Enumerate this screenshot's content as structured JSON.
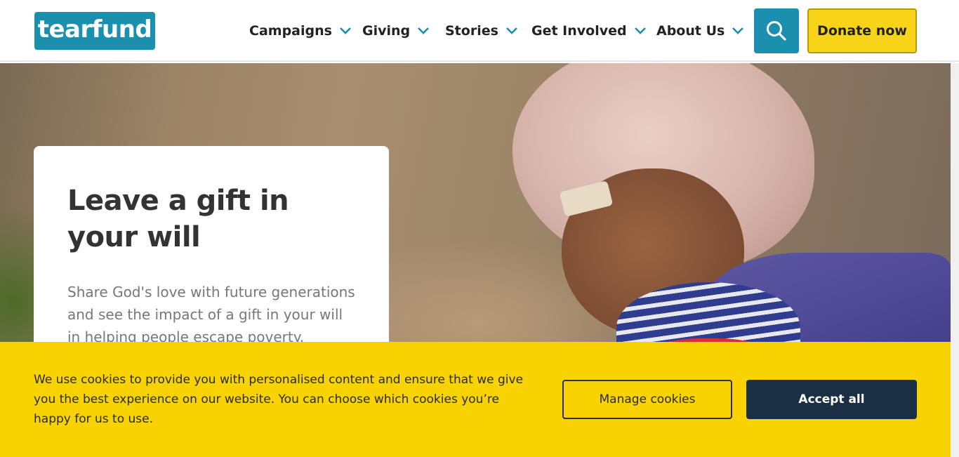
{
  "header": {
    "logo_text": "tearfund",
    "nav": [
      {
        "label": "Campaigns"
      },
      {
        "label": "Giving"
      },
      {
        "label": "Stories"
      },
      {
        "label": "Get Involved"
      },
      {
        "label": "About Us"
      }
    ],
    "search_icon": "search-icon",
    "donate_label": "Donate now"
  },
  "hero": {
    "title": "Leave a gift in your will",
    "description": "Share God's love with future generations and see the impact of a gift in your will in helping people escape poverty."
  },
  "cookie_banner": {
    "message": "We use cookies to provide you with personalised content and ensure that we give you the best experience on our website. You can choose which cookies you’re happy for us to use.",
    "manage_label": "Manage cookies",
    "accept_label": "Accept all"
  },
  "colors": {
    "brand_teal": "#1a8fae",
    "donate_yellow": "#f7d417",
    "cookie_yellow": "#f9d301",
    "accept_navy": "#1b2f44"
  }
}
